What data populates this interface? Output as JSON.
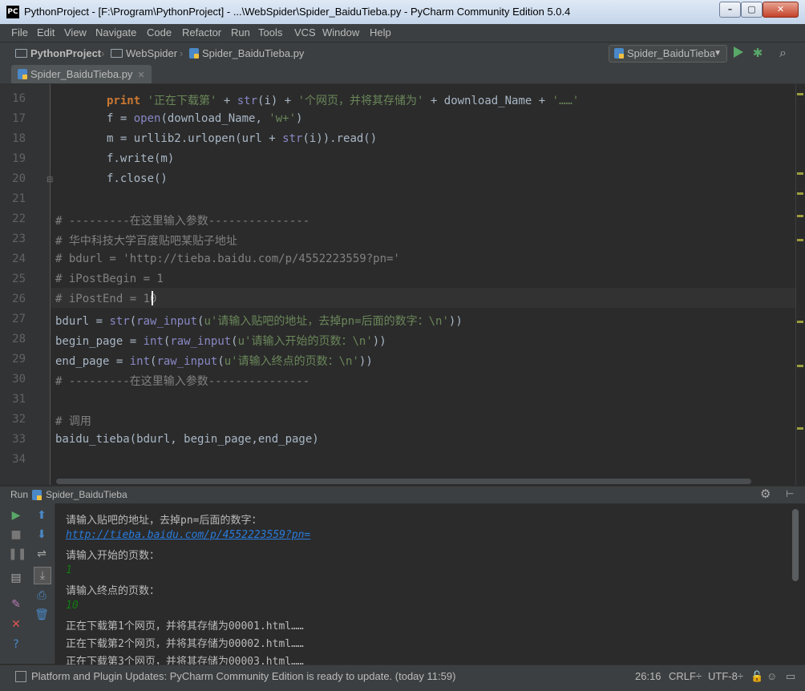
{
  "window": {
    "title": "PythonProject - [F:\\Program\\PythonProject] - ...\\WebSpider\\Spider_BaiduTieba.py - PyCharm Community Edition 5.0.4",
    "app_icon": "PC"
  },
  "menu": [
    "File",
    "Edit",
    "View",
    "Navigate",
    "Code",
    "Refactor",
    "Run",
    "Tools",
    "VCS",
    "Window",
    "Help"
  ],
  "breadcrumb": [
    "PythonProject",
    "WebSpider",
    "Spider_BaiduTieba.py"
  ],
  "run_config": "Spider_BaiduTieba",
  "tab": {
    "label": "Spider_BaiduTieba.py"
  },
  "editor": {
    "lines": [
      {
        "num": "16"
      },
      {
        "num": "17"
      },
      {
        "num": "18"
      },
      {
        "num": "19"
      },
      {
        "num": "20"
      },
      {
        "num": "21"
      },
      {
        "num": "22"
      },
      {
        "num": "23"
      },
      {
        "num": "24"
      },
      {
        "num": "25"
      },
      {
        "num": "26"
      },
      {
        "num": "27"
      },
      {
        "num": "28"
      },
      {
        "num": "29"
      },
      {
        "num": "30"
      },
      {
        "num": "31"
      },
      {
        "num": "32"
      },
      {
        "num": "33"
      },
      {
        "num": "34"
      }
    ],
    "code": {
      "l16_kw": "print",
      "l16_s1": "'正在下载第'",
      "l16_a": " + ",
      "l16_fn": "str",
      "l16_b": "(i) + ",
      "l16_s2": "'个网页，并将其存储为'",
      "l16_c": " + download_Name + ",
      "l16_s3": "'……'",
      "l17_a": "f = ",
      "l17_fn": "open",
      "l17_b": "(download_Name, ",
      "l17_s": "'w+'",
      "l17_c": ")",
      "l18_a": "m = urllib2.urlopen(url + ",
      "l18_fn": "str",
      "l18_b": "(i)).read()",
      "l19": "f.write(m)",
      "l20": "f.close()",
      "l22": "# ---------在这里输入参数---------------",
      "l23": "# 华中科技大学百度贴吧某贴子地址",
      "l24": "# bdurl = 'http://tieba.baidu.com/p/4552223559?pn='",
      "l25": "# iPostBegin = 1",
      "l26": "# iPostEnd = 10",
      "l27_a": "bdurl = ",
      "l27_fn1": "str",
      "l27_b": "(",
      "l27_fn2": "raw_input",
      "l27_c": "(",
      "l27_s": "u'请输入贴吧的地址，去掉pn=后面的数字：\\n'",
      "l27_d": "))",
      "l28_a": "begin_page = ",
      "l28_fn1": "int",
      "l28_b": "(",
      "l28_fn2": "raw_input",
      "l28_c": "(",
      "l28_s": "u'请输入开始的页数：\\n'",
      "l28_d": "))",
      "l29_a": "end_page = ",
      "l29_fn1": "int",
      "l29_b": "(",
      "l29_fn2": "raw_input",
      "l29_c": "(",
      "l29_s": "u'请输入终点的页数：\\n'",
      "l29_d": "))",
      "l30": "# ---------在这里输入参数---------------",
      "l32": "# 调用",
      "l33": "baidu_tieba(bdurl, begin_page,end_page)"
    }
  },
  "run_panel": {
    "label": "Run",
    "config": "Spider_BaiduTieba",
    "output": {
      "o1": "请输入贴吧的地址，去掉pn=后面的数字：",
      "o2": "http://tieba.baidu.com/p/4552223559?pn=",
      "o3": "请输入开始的页数：",
      "o4": "1",
      "o5": "请输入终点的页数：",
      "o6": "10",
      "o7": "正在下载第1个网页，并将其存储为00001.html……",
      "o8": "正在下载第2个网页，并将其存储为00002.html……",
      "o9": "正在下载第3个网页，并将其存储为00003.html……"
    }
  },
  "status": {
    "message": "Platform and Plugin Updates: PyCharm Community Edition is ready to update. (today 11:59)",
    "position": "26:16",
    "line_sep": "CRLF÷",
    "encoding": "UTF-8÷"
  },
  "colors": {
    "keyword": "#cc7832",
    "string": "#6a8759",
    "builtin": "#8888c6",
    "comment": "#808080",
    "link": "#287bde",
    "run_green": "#59a869"
  }
}
